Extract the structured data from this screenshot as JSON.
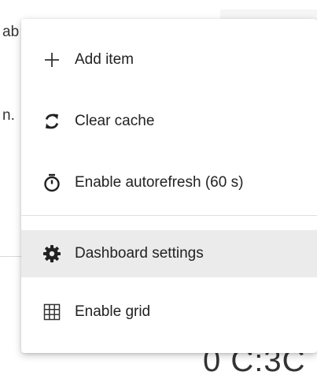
{
  "background": {
    "partial_text_1": "ab",
    "partial_text_2": "n.",
    "partial_number": "0 C:3C"
  },
  "menu": {
    "items": [
      {
        "label": "Add item",
        "icon": "plus-icon"
      },
      {
        "label": "Clear cache",
        "icon": "refresh-icon"
      },
      {
        "label": "Enable autorefresh (60 s)",
        "icon": "timer-icon"
      },
      {
        "label": "Dashboard settings",
        "icon": "gear-icon"
      },
      {
        "label": "Enable grid",
        "icon": "grid-icon"
      }
    ],
    "active_index": 3
  },
  "colors": {
    "active_background": "#ebebeb",
    "text": "#222222"
  }
}
